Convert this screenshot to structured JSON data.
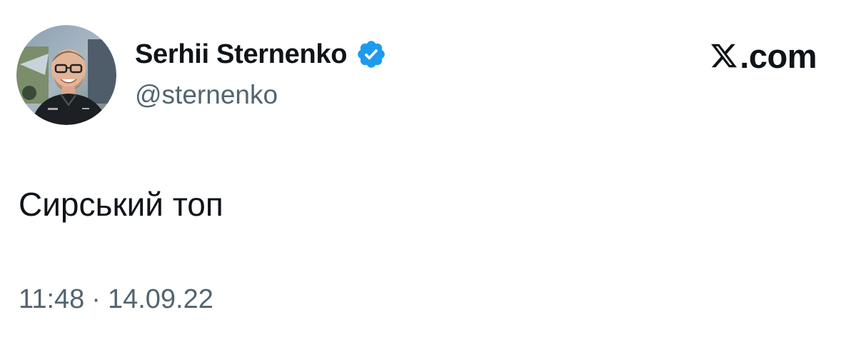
{
  "author": {
    "display_name": "Serhii Sternenko",
    "handle": "@sternenko",
    "verified": true,
    "avatar_icon": "user-photo"
  },
  "brand": {
    "logo_icon": "x-logo-icon",
    "domain": ".com"
  },
  "tweet": {
    "text": "Сирський топ",
    "time": "11:48",
    "separator": "·",
    "date": "14.09.22"
  },
  "colors": {
    "text_primary": "#0f1419",
    "text_secondary": "#536471",
    "verified_blue": "#1d9bf0",
    "background": "#ffffff"
  }
}
